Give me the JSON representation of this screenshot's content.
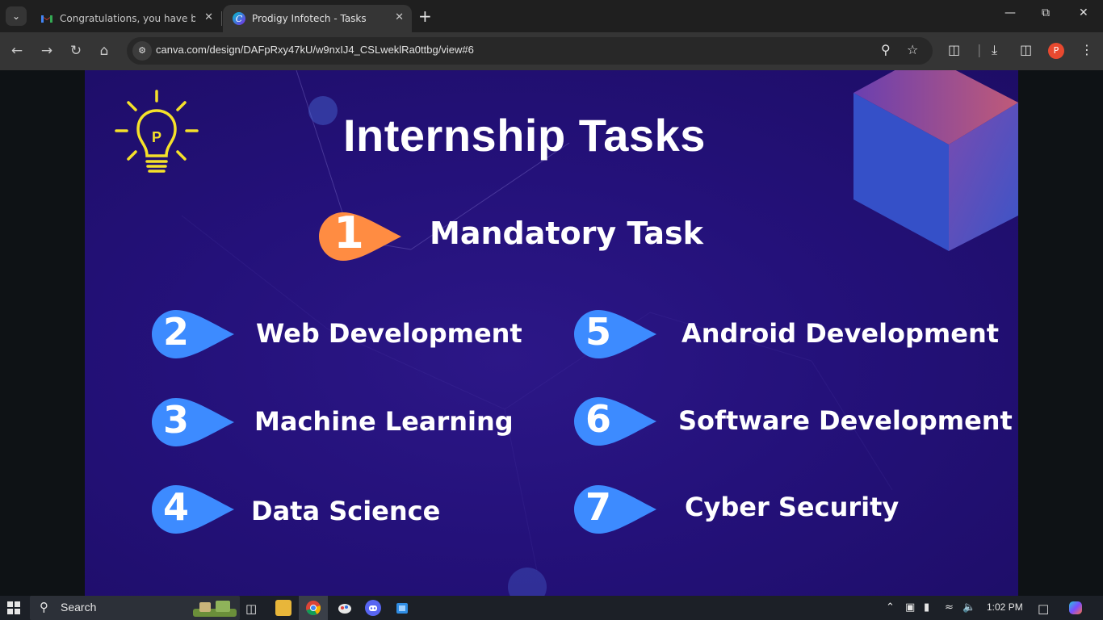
{
  "browser": {
    "tabs": [
      {
        "title": "Congratulations, you have been",
        "favicon": "gmail-icon",
        "active": false
      },
      {
        "title": "Prodigy Infotech - Tasks",
        "favicon": "canva-icon",
        "active": true
      }
    ],
    "url": "canva.com/design/DAFpRxy47kU/w9nxIJ4_CSLweklRa0ttbg/view#6",
    "profile_initial": "P"
  },
  "slide": {
    "title": "Internship Tasks",
    "accent_orange": "#ff8c42",
    "accent_blue": "#3d8bff",
    "logo_color": "#f5e12a",
    "logo_letter": "P",
    "tasks": [
      {
        "number": "1",
        "label": "Mandatory Task"
      },
      {
        "number": "2",
        "label": "Web Development"
      },
      {
        "number": "3",
        "label": "Machine Learning"
      },
      {
        "number": "4",
        "label": "Data Science"
      },
      {
        "number": "5",
        "label": "Android Development"
      },
      {
        "number": "6",
        "label": "Software Development"
      },
      {
        "number": "7",
        "label": "Cyber Security"
      }
    ]
  },
  "taskbar": {
    "search_placeholder": "Search",
    "time": "1:02 PM"
  }
}
